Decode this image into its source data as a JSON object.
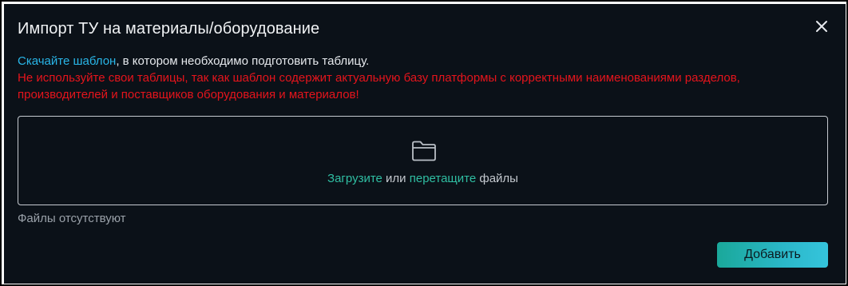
{
  "dialog": {
    "title": "Импорт ТУ на материалы/оборудование",
    "close_icon": "close-icon"
  },
  "info": {
    "download_link": "Скачайте шаблон",
    "download_rest": ", в котором необходимо подготовить таблицу.",
    "warning": "Не используйте свои таблицы, так как шаблон содержит актуальную базу платформы с корректными наименованиями разделов, производителей и поставщиков оборудования и материалов!"
  },
  "dropzone": {
    "icon": "folder-icon",
    "upload_link": "Загрузите",
    "middle": " или ",
    "drag_link": "перетащите",
    "suffix": " файлы"
  },
  "files": {
    "status": "Файлы отсутствуют"
  },
  "footer": {
    "add_label": "Добавить"
  },
  "colors": {
    "background": "#0b1118",
    "link_blue": "#29b6e8",
    "warning_red": "#e5141c",
    "accent_teal": "#2fbea2",
    "button_gradient_start": "#1aa89a",
    "button_gradient_end": "#35c4dc"
  }
}
